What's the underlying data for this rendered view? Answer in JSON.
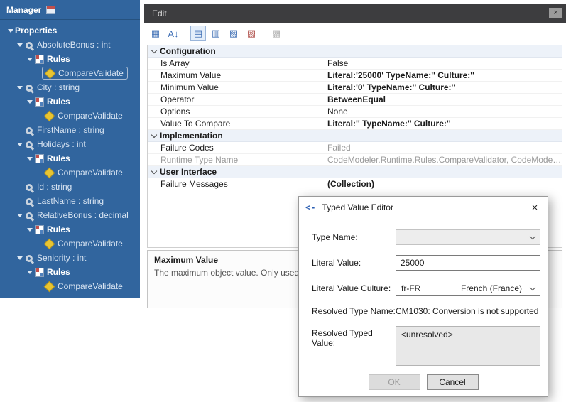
{
  "tree": {
    "title": "Manager",
    "items": [
      {
        "label": "Properties"
      },
      {
        "label": "AbsoluteBonus : int"
      },
      {
        "label": "Rules"
      },
      {
        "label": "CompareValidate"
      },
      {
        "label": "City : string"
      },
      {
        "label": "Rules"
      },
      {
        "label": "CompareValidate"
      },
      {
        "label": "FirstName : string"
      },
      {
        "label": "Holidays : int"
      },
      {
        "label": "Rules"
      },
      {
        "label": "CompareValidate"
      },
      {
        "label": "Id : string"
      },
      {
        "label": "LastName : string"
      },
      {
        "label": "RelativeBonus : decimal"
      },
      {
        "label": "Rules"
      },
      {
        "label": "CompareValidate"
      },
      {
        "label": "Seniority : int"
      },
      {
        "label": "Rules"
      },
      {
        "label": "CompareValidate"
      }
    ]
  },
  "edit": {
    "title": "Edit",
    "close_glyph": "×"
  },
  "toolbar": {
    "icons": [
      {
        "glyph": "▦"
      },
      {
        "glyph": "A↓"
      },
      {
        "glyph": "▤"
      },
      {
        "glyph": "▥"
      },
      {
        "glyph": "▧"
      },
      {
        "glyph": "▨"
      },
      {
        "glyph": "▩"
      }
    ]
  },
  "grid": {
    "rows": [
      {
        "label": "Configuration"
      },
      {
        "label": "Is Array",
        "value": "False"
      },
      {
        "label": "Maximum Value",
        "value": "Literal:'25000' TypeName:'' Culture:''"
      },
      {
        "label": "Minimum Value",
        "value": "Literal:'0' TypeName:'' Culture:''"
      },
      {
        "label": "Operator",
        "value": "BetweenEqual"
      },
      {
        "label": "Options",
        "value": "None"
      },
      {
        "label": "Value To Compare",
        "value": "Literal:'' TypeName:'' Culture:''"
      },
      {
        "label": "Implementation"
      },
      {
        "label": "Failure Codes",
        "value": "Failed"
      },
      {
        "label": "Runtime Type Name",
        "value": "CodeModeler.Runtime.Rules.CompareValidator, CodeModeler.Runtime"
      },
      {
        "label": "User Interface"
      },
      {
        "label": "Failure Messages",
        "value": "(Collection)"
      }
    ]
  },
  "description": {
    "title": "Maximum Value",
    "text": "The maximum object value. Only used for bin"
  },
  "dialog": {
    "title": "Typed Value Editor",
    "back_glyph": "<-",
    "close_glyph": "×",
    "type_name_label": "Type Name:",
    "literal_value_label": "Literal Value:",
    "literal_value": "25000",
    "culture_label": "Literal Value Culture:",
    "culture_code": "fr-FR",
    "culture_name": "French (France)",
    "resolved_type_label": "Resolved Type Name:",
    "resolved_type_value": "CM1030: Conversion is not supported",
    "resolved_value_label": "Resolved Typed Value:",
    "resolved_value": "<unresolved>",
    "ok_label": "OK",
    "cancel_label": "Cancel"
  }
}
